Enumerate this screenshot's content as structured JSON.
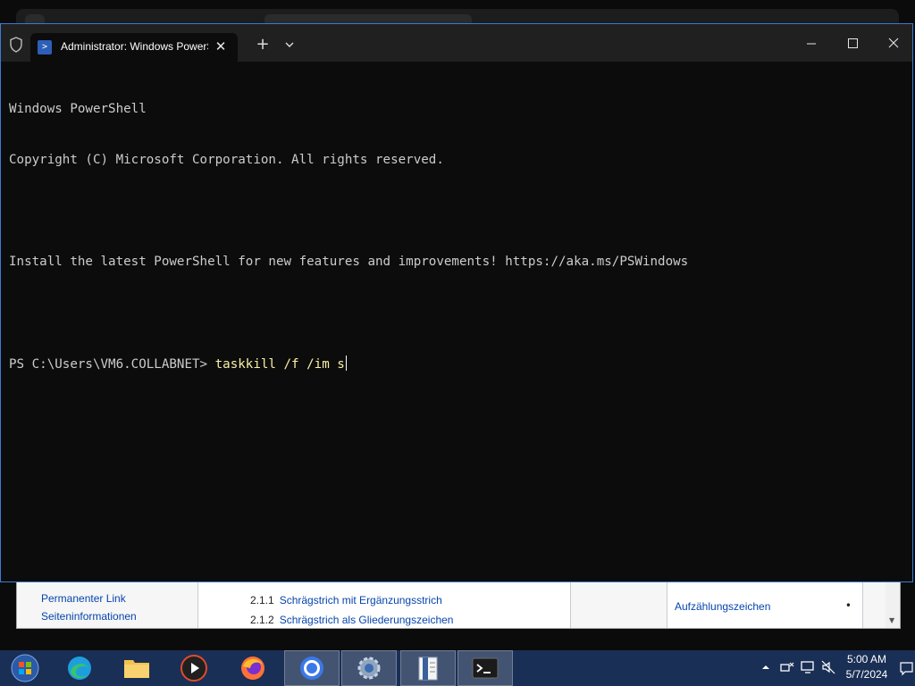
{
  "terminal": {
    "tab_title": "Administrator: Windows PowerShell",
    "new_tab_symbol": "+",
    "close_symbol": "✕",
    "lines": [
      "Windows PowerShell",
      "Copyright (C) Microsoft Corporation. All rights reserved.",
      "",
      "Install the latest PowerShell for new features and improvements! https://aka.ms/PSWindows",
      ""
    ],
    "prompt": "PS C:\\Users\\VM6.COLLABNET> ",
    "command": "taskkill /f /im s"
  },
  "background_browser": {
    "sidebar_links": [
      "Permanenter Link",
      "Seiteninformationen"
    ],
    "toc": [
      {
        "num": "2.1.1",
        "text": "Schrägstrich mit Ergänzungsstrich"
      },
      {
        "num": "2.1.2",
        "text": "Schrägstrich als Gliederungszeichen"
      }
    ],
    "table": [
      {
        "name": "Aufzählungszeichen",
        "symbol": "•"
      }
    ]
  },
  "taskbar": {
    "apps": [
      {
        "name": "start-button",
        "icon": "windows-logo-icon"
      },
      {
        "name": "edge",
        "icon": "edge-icon"
      },
      {
        "name": "file-explorer",
        "icon": "folder-icon"
      },
      {
        "name": "media-player",
        "icon": "media-player-icon"
      },
      {
        "name": "firefox",
        "icon": "firefox-icon"
      },
      {
        "name": "chrome",
        "icon": "chrome-icon"
      },
      {
        "name": "settings",
        "icon": "gear-icon"
      },
      {
        "name": "notepad",
        "icon": "notepad-icon"
      },
      {
        "name": "terminal",
        "icon": "terminal-icon",
        "active": true
      }
    ],
    "time": "5:00 AM",
    "date": "5/7/2024"
  },
  "colors": {
    "terminal_bg": "#0c0c0c",
    "titlebar_bg": "#202020",
    "text": "#cccccc",
    "command": "#f9f1a5",
    "window_border": "#3a7bd5",
    "taskbar_bg": "#1a2f55"
  }
}
